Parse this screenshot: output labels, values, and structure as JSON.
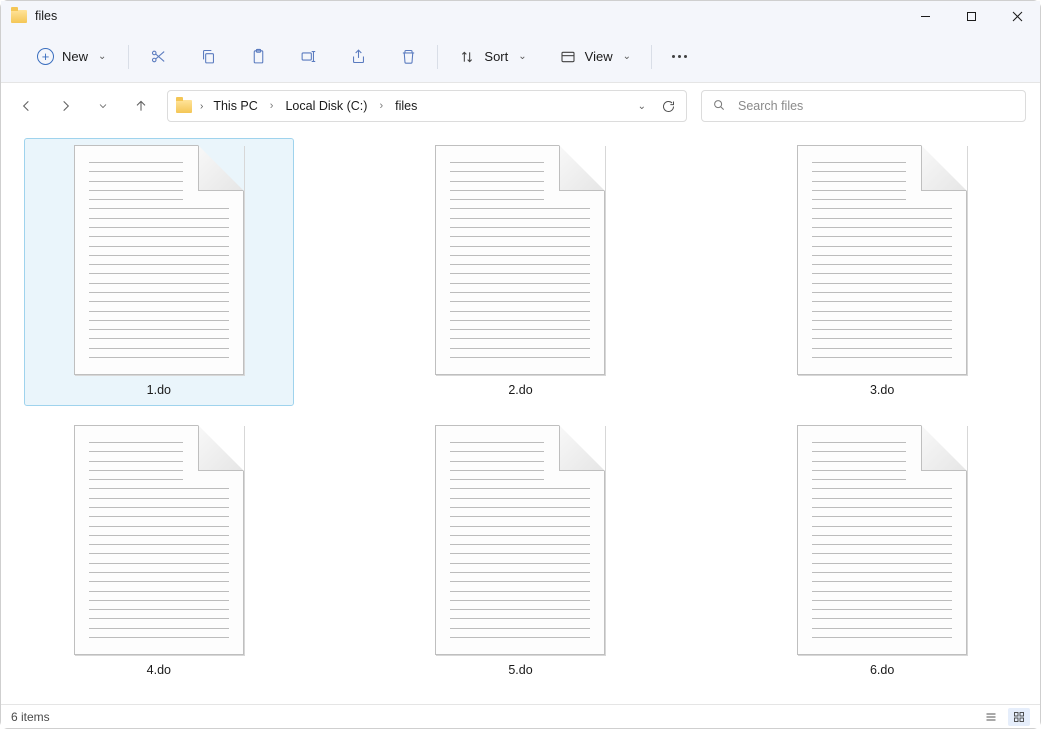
{
  "window": {
    "title": "files"
  },
  "toolbar": {
    "new_label": "New",
    "sort_label": "Sort",
    "view_label": "View"
  },
  "breadcrumb": {
    "seg1": "This PC",
    "seg2": "Local Disk (C:)",
    "seg3": "files"
  },
  "search": {
    "placeholder": "Search files"
  },
  "files": [
    {
      "name": "1.do",
      "selected": true
    },
    {
      "name": "2.do",
      "selected": false
    },
    {
      "name": "3.do",
      "selected": false
    },
    {
      "name": "4.do",
      "selected": false
    },
    {
      "name": "5.do",
      "selected": false
    },
    {
      "name": "6.do",
      "selected": false
    }
  ],
  "status": {
    "text": "6 items"
  }
}
